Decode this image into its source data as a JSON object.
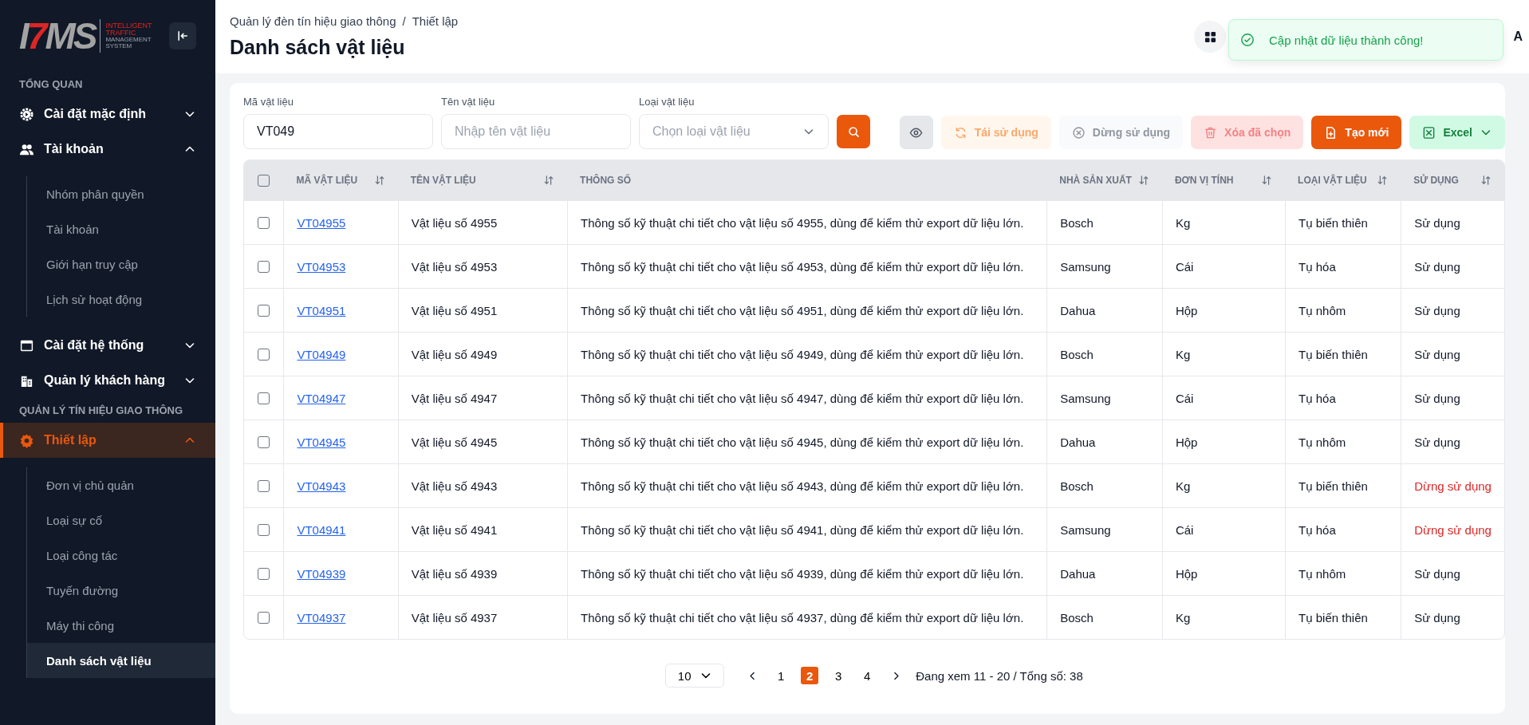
{
  "logo": {
    "mark": "I7MS",
    "tagline": [
      "INTELLIGENT",
      "TRAFFIC",
      "MANAGEMENT",
      "SYSTEM"
    ]
  },
  "sidebar": {
    "sections": [
      {
        "label": "TỔNG QUAN",
        "items": [
          {
            "label": "Cài đặt mặc định",
            "kind": "gear",
            "expanded": false,
            "selected": false
          },
          {
            "label": "Tài khoản",
            "kind": "users",
            "expanded": true,
            "selected": false,
            "children": [
              {
                "label": "Nhóm phân quyền",
                "selected": false
              },
              {
                "label": "Tài khoản",
                "selected": false
              },
              {
                "label": "Giới hạn truy cập",
                "selected": false
              },
              {
                "label": "Lịch sử hoạt động",
                "selected": false
              }
            ]
          },
          {
            "label": "Cài đặt hệ thống",
            "kind": "window",
            "expanded": false,
            "selected": false
          },
          {
            "label": "Quản lý khách hàng",
            "kind": "building",
            "expanded": false,
            "selected": false
          }
        ]
      },
      {
        "label": "QUẢN LÝ TÍN HIỆU GIAO THÔNG",
        "items": [
          {
            "label": "Thiết lập",
            "kind": "cog",
            "expanded": true,
            "selected": true,
            "children": [
              {
                "label": "Đơn vị chủ quản",
                "selected": false
              },
              {
                "label": "Loại sự cố",
                "selected": false
              },
              {
                "label": "Loại công tác",
                "selected": false
              },
              {
                "label": "Tuyến đường",
                "selected": false
              },
              {
                "label": "Máy thi công",
                "selected": false
              },
              {
                "label": "Danh sách vật liệu",
                "selected": true
              }
            ]
          }
        ]
      }
    ]
  },
  "header": {
    "breadcrumb": [
      "Quản lý đèn tín hiệu giao thông",
      "Thiết lập"
    ],
    "separator": "/",
    "title": "Danh sách vật liệu",
    "user_initial": "A"
  },
  "toast": {
    "message": "Cập nhật dữ liệu thành công!"
  },
  "filters": [
    {
      "label": "Mã vật liệu",
      "kind": "text",
      "value": "VT049"
    },
    {
      "label": "Tên vật liệu",
      "kind": "text",
      "placeholder": "Nhập tên vật liệu"
    },
    {
      "label": "Loại vật liệu",
      "kind": "select",
      "placeholder": "Chọn loại vật liệu"
    }
  ],
  "toolbar": [
    {
      "kind": "view",
      "disabled": false
    },
    {
      "kind": "reuse",
      "label": "Tái sử dụng",
      "disabled": true
    },
    {
      "kind": "stop",
      "label": "Dừng sử dụng",
      "disabled": true
    },
    {
      "kind": "delete",
      "label": "Xóa đã chọn",
      "disabled": true
    },
    {
      "kind": "create",
      "label": "Tạo mới",
      "disabled": false
    },
    {
      "kind": "excel",
      "label": "Excel",
      "disabled": false
    }
  ],
  "table": {
    "columns": [
      {
        "label": "MÃ VẬT LIỆU",
        "sortable": true
      },
      {
        "label": "TÊN VẬT LIỆU",
        "sortable": true
      },
      {
        "label": "THÔNG SỐ",
        "sortable": false
      },
      {
        "label": "NHÀ SẢN XUẤT",
        "sortable": true
      },
      {
        "label": "ĐƠN VỊ TÍNH",
        "sortable": true
      },
      {
        "label": "LOẠI VẬT LIỆU",
        "sortable": true
      },
      {
        "label": "SỬ DỤNG",
        "sortable": true
      }
    ],
    "all_checked": false,
    "rows": [
      {
        "checked": false,
        "code": "VT04955",
        "name": "Vật liệu số 4955",
        "spec": "Thông số kỹ thuật chi tiết cho vật liệu số 4955, dùng để kiểm thử export dữ liệu lớn.",
        "maker": "Bosch",
        "unit": "Kg",
        "type": "Tụ biến thiên",
        "usage": "Sử dụng",
        "stopped": false
      },
      {
        "checked": false,
        "code": "VT04953",
        "name": "Vật liệu số 4953",
        "spec": "Thông số kỹ thuật chi tiết cho vật liệu số 4953, dùng để kiểm thử export dữ liệu lớn.",
        "maker": "Samsung",
        "unit": "Cái",
        "type": "Tụ hóa",
        "usage": "Sử dụng",
        "stopped": false
      },
      {
        "checked": false,
        "code": "VT04951",
        "name": "Vật liệu số 4951",
        "spec": "Thông số kỹ thuật chi tiết cho vật liệu số 4951, dùng để kiểm thử export dữ liệu lớn.",
        "maker": "Dahua",
        "unit": "Hộp",
        "type": "Tụ nhôm",
        "usage": "Sử dụng",
        "stopped": false
      },
      {
        "checked": false,
        "code": "VT04949",
        "name": "Vật liệu số 4949",
        "spec": "Thông số kỹ thuật chi tiết cho vật liệu số 4949, dùng để kiểm thử export dữ liệu lớn.",
        "maker": "Bosch",
        "unit": "Kg",
        "type": "Tụ biến thiên",
        "usage": "Sử dụng",
        "stopped": false
      },
      {
        "checked": false,
        "code": "VT04947",
        "name": "Vật liệu số 4947",
        "spec": "Thông số kỹ thuật chi tiết cho vật liệu số 4947, dùng để kiểm thử export dữ liệu lớn.",
        "maker": "Samsung",
        "unit": "Cái",
        "type": "Tụ hóa",
        "usage": "Sử dụng",
        "stopped": false
      },
      {
        "checked": false,
        "code": "VT04945",
        "name": "Vật liệu số 4945",
        "spec": "Thông số kỹ thuật chi tiết cho vật liệu số 4945, dùng để kiểm thử export dữ liệu lớn.",
        "maker": "Dahua",
        "unit": "Hộp",
        "type": "Tụ nhôm",
        "usage": "Sử dụng",
        "stopped": false
      },
      {
        "checked": false,
        "code": "VT04943",
        "name": "Vật liệu số 4943",
        "spec": "Thông số kỹ thuật chi tiết cho vật liệu số 4943, dùng để kiểm thử export dữ liệu lớn.",
        "maker": "Bosch",
        "unit": "Kg",
        "type": "Tụ biến thiên",
        "usage": "Dừng sử dụng",
        "stopped": true
      },
      {
        "checked": false,
        "code": "VT04941",
        "name": "Vật liệu số 4941",
        "spec": "Thông số kỹ thuật chi tiết cho vật liệu số 4941, dùng để kiểm thử export dữ liệu lớn.",
        "maker": "Samsung",
        "unit": "Cái",
        "type": "Tụ hóa",
        "usage": "Dừng sử dụng",
        "stopped": true
      },
      {
        "checked": false,
        "code": "VT04939",
        "name": "Vật liệu số 4939",
        "spec": "Thông số kỹ thuật chi tiết cho vật liệu số 4939, dùng để kiểm thử export dữ liệu lớn.",
        "maker": "Dahua",
        "unit": "Hộp",
        "type": "Tụ nhôm",
        "usage": "Sử dụng",
        "stopped": false
      },
      {
        "checked": false,
        "code": "VT04937",
        "name": "Vật liệu số 4937",
        "spec": "Thông số kỹ thuật chi tiết cho vật liệu số 4937, dùng để kiểm thử export dữ liệu lớn.",
        "maker": "Bosch",
        "unit": "Kg",
        "type": "Tụ biến thiên",
        "usage": "Sử dụng",
        "stopped": false
      }
    ]
  },
  "pagination": {
    "page_size": "10",
    "pages": [
      {
        "label": "1",
        "selected": false
      },
      {
        "label": "2",
        "selected": true
      },
      {
        "label": "3",
        "selected": false
      },
      {
        "label": "4",
        "selected": false
      }
    ],
    "info": "Đang xem 11 - 20 / Tổng số: 38"
  }
}
